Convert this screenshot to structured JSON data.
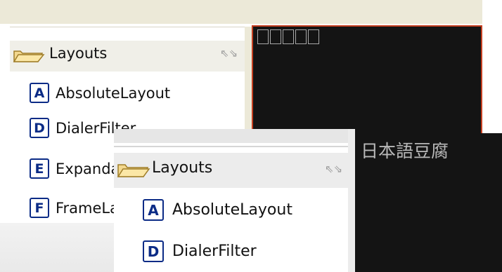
{
  "back_panel": {
    "section_title": "Layouts",
    "tofu_count": 5,
    "items": [
      {
        "badge": "A",
        "label": "AbsoluteLayout"
      },
      {
        "badge": "D",
        "label": "DialerFilter"
      },
      {
        "badge": "E",
        "label": "ExpandableListView"
      },
      {
        "badge": "F",
        "label": "FrameLayout"
      }
    ]
  },
  "front_panel": {
    "section_title": "Layouts",
    "preview_text": "日本語豆腐",
    "items": [
      {
        "badge": "A",
        "label": "AbsoluteLayout"
      },
      {
        "badge": "D",
        "label": "DialerFilter"
      }
    ]
  },
  "colors": {
    "badge": "#0b2b86",
    "canvas": "#141414",
    "canvas_border": "#c53f20",
    "header": "#ececec"
  },
  "icons": {
    "folder": "folder-open-icon",
    "collapse": "collapse-arrows-icon"
  }
}
